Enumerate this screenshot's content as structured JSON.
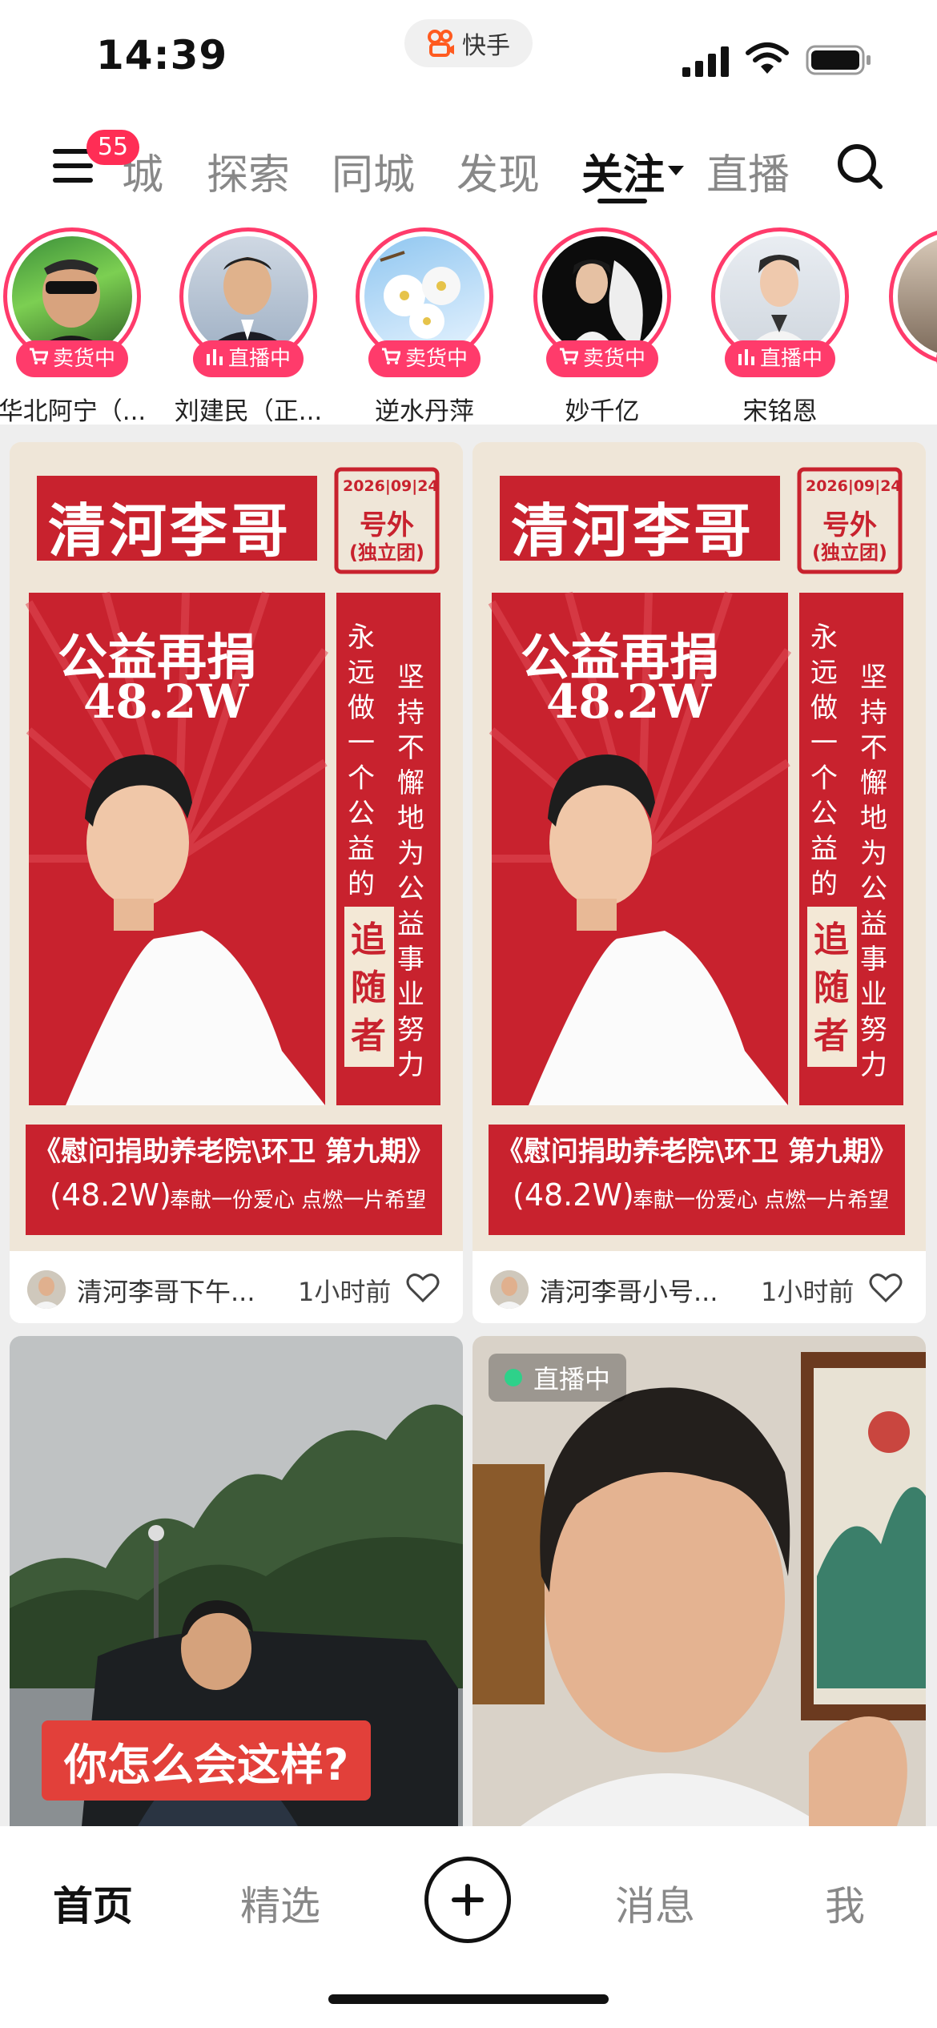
{
  "status_bar": {
    "time": "14:39",
    "app_name": "快手"
  },
  "top_nav": {
    "badge_count": "55",
    "tabs": [
      {
        "label": "城",
        "active": false
      },
      {
        "label": "探索",
        "active": false
      },
      {
        "label": "同城",
        "active": false
      },
      {
        "label": "发现",
        "active": false
      },
      {
        "label": "关注",
        "active": true
      },
      {
        "label": "直播",
        "active": false
      }
    ]
  },
  "stories": [
    {
      "name": "华北阿宁（...",
      "status": "卖货中",
      "status_icon": "cart-icon"
    },
    {
      "name": "刘建民（正...",
      "status": "直播中",
      "status_icon": "bars-icon"
    },
    {
      "name": "逆水丹萍",
      "status": "卖货中",
      "status_icon": "cart-icon"
    },
    {
      "name": "妙千亿",
      "status": "卖货中",
      "status_icon": "cart-icon"
    },
    {
      "name": "宋铭恩",
      "status": "直播中",
      "status_icon": "bars-icon"
    }
  ],
  "feed": [
    {
      "poster": {
        "name": "清河李哥",
        "date": "2026|09|24",
        "badge_line1": "号外",
        "badge_line2": "(独立团)",
        "headline1": "公益再捐",
        "headline2": "48.2W",
        "vertical_left": "永远做一个公益的",
        "vertical_highlight": "追随者",
        "vertical_right": "坚持不懈地为公益事业努力",
        "bottom_title": "《慰问捐助养老院\\环卫 第九期》",
        "bottom_amount": "(48.2W)",
        "bottom_slogan": "奉献一份爱心 点燃一片希望"
      },
      "author": "清河李哥下午...",
      "time": "1小时前"
    },
    {
      "poster": {
        "name": "清河李哥",
        "date": "2026|09|24",
        "badge_line1": "号外",
        "badge_line2": "(独立团)",
        "headline1": "公益再捐",
        "headline2": "48.2W",
        "vertical_left": "永远做一个公益的",
        "vertical_highlight": "追随者",
        "vertical_right": "坚持不懈地为公益事业努力",
        "bottom_title": "《慰问捐助养老院\\环卫 第九期》",
        "bottom_amount": "(48.2W)",
        "bottom_slogan": "奉献一份爱心 点燃一片希望"
      },
      "author": "清河李哥小号...",
      "time": "1小时前"
    },
    {
      "caption": "你怎么会这样?"
    },
    {
      "live_label": "直播中"
    }
  ],
  "tab_bar": {
    "home": "首页",
    "featured": "精选",
    "messages": "消息",
    "me": "我"
  },
  "colors": {
    "accent": "#ff3b6b",
    "poster_red": "#c8222e",
    "poster_cream": "#efe6d8",
    "live_dot": "#2ed18a"
  }
}
